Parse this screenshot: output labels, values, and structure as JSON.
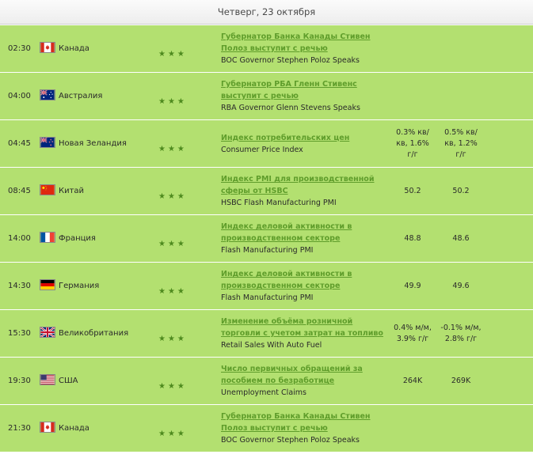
{
  "header": {
    "date": "Четверг, 23 октября"
  },
  "events": [
    {
      "time": "02:30",
      "flag": "ca-flag-icon",
      "country": "Канада",
      "stars": "★★★",
      "title_ru": "Губернатор Банка Канады Стивен Полоз выступит с речью",
      "title_en": "BOC Governor Stephen Poloz Speaks",
      "previous": "",
      "forecast": ""
    },
    {
      "time": "04:00",
      "flag": "au-flag-icon",
      "country": "Австралия",
      "stars": "★★★",
      "title_ru": "Губернатор РБА Гленн Стивенс выступит с речью",
      "title_en": "RBA Governor Glenn Stevens Speaks",
      "previous": "",
      "forecast": ""
    },
    {
      "time": "04:45",
      "flag": "nz-flag-icon",
      "country": "Новая Зеландия",
      "stars": "★★★",
      "title_ru": "Индекс потребительских цен",
      "title_en": "Consumer Price Index",
      "previous": "0.3% кв/кв, 1.6% г/г",
      "forecast": "0.5% кв/кв, 1.2% г/г"
    },
    {
      "time": "08:45",
      "flag": "cn-flag-icon",
      "country": "Китай",
      "stars": "★★★",
      "title_ru": "Индекс PMI для производственной сферы от HSBC",
      "title_en": "HSBC Flash Manufacturing PMI",
      "previous": "50.2",
      "forecast": "50.2"
    },
    {
      "time": "14:00",
      "flag": "fr-flag-icon",
      "country": "Франция",
      "stars": "★★★",
      "title_ru": "Индекс деловой активности в производственном секторе",
      "title_en": "Flash Manufacturing PMI",
      "previous": "48.8",
      "forecast": "48.6"
    },
    {
      "time": "14:30",
      "flag": "de-flag-icon",
      "country": "Германия",
      "stars": "★★★",
      "title_ru": "Индекс деловой активности в производственном секторе",
      "title_en": "Flash Manufacturing PMI",
      "previous": "49.9",
      "forecast": "49.6"
    },
    {
      "time": "15:30",
      "flag": "gb-flag-icon",
      "country": "Великобритания",
      "stars": "★★★",
      "title_ru": "Изменение объёма розничной торговли с учетом затрат на топливо",
      "title_en": "Retail Sales With Auto Fuel",
      "previous": "0.4% м/м, 3.9% г/г",
      "forecast": "-0.1% м/м, 2.8% г/г"
    },
    {
      "time": "19:30",
      "flag": "us-flag-icon",
      "country": "США",
      "stars": "★★★",
      "title_ru": "Число первичных обращений за пособием по безработице",
      "title_en": "Unemployment Claims",
      "previous": "264K",
      "forecast": "269K"
    },
    {
      "time": "21:30",
      "flag": "ca-flag-icon",
      "country": "Канада",
      "stars": "★★★",
      "title_ru": "Губернатор Банка Канады Стивен Полоз выступит с речью",
      "title_en": "BOC Governor Stephen Poloz Speaks",
      "previous": "",
      "forecast": ""
    }
  ]
}
